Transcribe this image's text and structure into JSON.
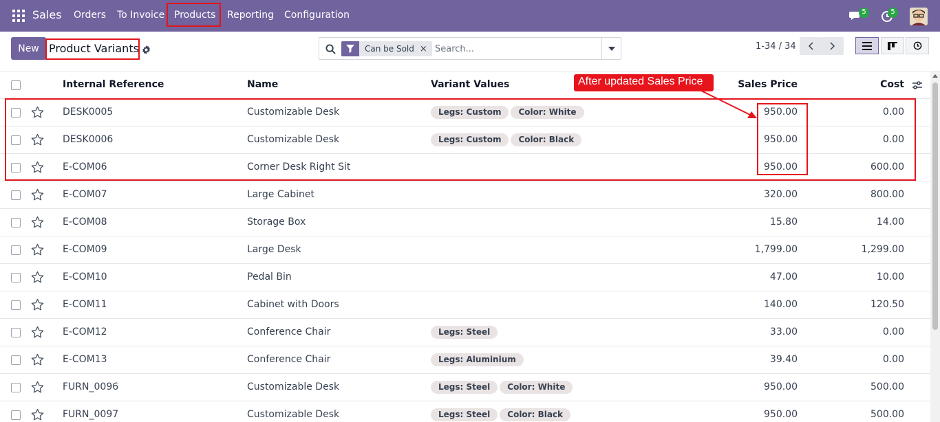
{
  "app": {
    "name": "Sales",
    "menu": [
      "Orders",
      "To Invoice",
      "Products",
      "Reporting",
      "Configuration"
    ],
    "active_menu": "Products",
    "messages_count": "5",
    "activities_count": "5"
  },
  "control_panel": {
    "new_label": "New",
    "breadcrumb": "Product Variants",
    "filter_facet": "Can be Sold",
    "search_placeholder": "Search...",
    "pager": "1-34 / 34"
  },
  "table": {
    "headers": {
      "internal_reference": "Internal Reference",
      "name": "Name",
      "variant_values": "Variant Values",
      "sales_price": "Sales Price",
      "cost": "Cost"
    },
    "rows": [
      {
        "ref": "DESK0005",
        "name": "Customizable Desk",
        "tags": [
          "Legs: Custom",
          "Color: White"
        ],
        "price": "950.00",
        "cost": "0.00"
      },
      {
        "ref": "DESK0006",
        "name": "Customizable Desk",
        "tags": [
          "Legs: Custom",
          "Color: Black"
        ],
        "price": "950.00",
        "cost": "0.00"
      },
      {
        "ref": "E-COM06",
        "name": "Corner Desk Right Sit",
        "tags": [],
        "price": "950.00",
        "cost": "600.00"
      },
      {
        "ref": "E-COM07",
        "name": "Large Cabinet",
        "tags": [],
        "price": "320.00",
        "cost": "800.00"
      },
      {
        "ref": "E-COM08",
        "name": "Storage Box",
        "tags": [],
        "price": "15.80",
        "cost": "14.00"
      },
      {
        "ref": "E-COM09",
        "name": "Large Desk",
        "tags": [],
        "price": "1,799.00",
        "cost": "1,299.00"
      },
      {
        "ref": "E-COM10",
        "name": "Pedal Bin",
        "tags": [],
        "price": "47.00",
        "cost": "10.00"
      },
      {
        "ref": "E-COM11",
        "name": "Cabinet with Doors",
        "tags": [],
        "price": "140.00",
        "cost": "120.50"
      },
      {
        "ref": "E-COM12",
        "name": "Conference Chair",
        "tags": [
          "Legs: Steel"
        ],
        "price": "33.00",
        "cost": "0.00"
      },
      {
        "ref": "E-COM13",
        "name": "Conference Chair",
        "tags": [
          "Legs: Aluminium"
        ],
        "price": "39.40",
        "cost": "0.00"
      },
      {
        "ref": "FURN_0096",
        "name": "Customizable Desk",
        "tags": [
          "Legs: Steel",
          "Color: White"
        ],
        "price": "950.00",
        "cost": "500.00"
      },
      {
        "ref": "FURN_0097",
        "name": "Customizable Desk",
        "tags": [
          "Legs: Steel",
          "Color: Black"
        ],
        "price": "950.00",
        "cost": "500.00"
      }
    ]
  },
  "annotation": {
    "label": "After updated Sales Price",
    "color": "#e8141c"
  },
  "colors": {
    "brand": "#71639e",
    "highlight": "#e4141b",
    "badge": "#28a745"
  }
}
